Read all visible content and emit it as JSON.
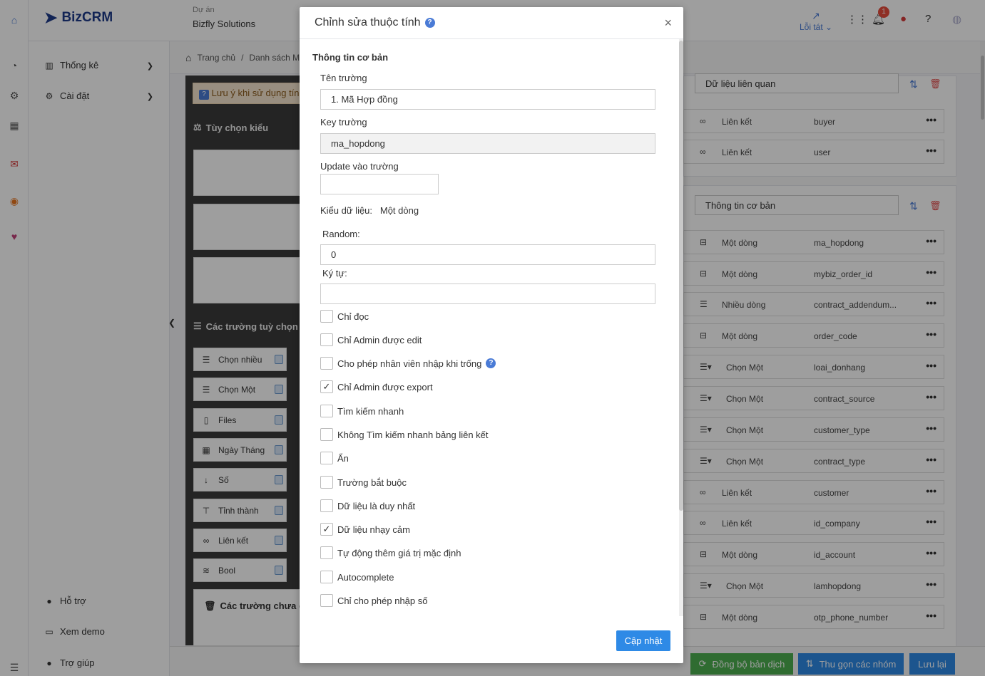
{
  "app": {
    "logo_text": "BizCRM",
    "brand_color": "#1e3a8a"
  },
  "header": {
    "project_label": "Dự án",
    "project_value": "Bizfly Solutions",
    "error_label": "Lỗi tát",
    "notification_count": "1"
  },
  "sidebar": {
    "items": [
      {
        "label": "Thống kê",
        "icon": "bar-chart-icon"
      },
      {
        "label": "Cài đặt",
        "icon": "gear-icon"
      }
    ],
    "bottom_items": [
      {
        "label": "Hỗ trợ",
        "icon": "info-icon"
      },
      {
        "label": "Xem demo",
        "icon": "monitor-icon"
      },
      {
        "label": "Trợ giúp",
        "icon": "help-icon"
      }
    ]
  },
  "breadcrumb": {
    "home": "Trang chủ",
    "separator": "/",
    "current": "Danh sách M"
  },
  "left_panel": {
    "notice": "Lưu ý khi sử dụng tính",
    "style_options_title": "Tùy chọn kiểu",
    "custom_fields_title": "Các trường tuỳ chọn",
    "unused_fields_title": "Các trường chưa dùng",
    "field_types": [
      "Chọn nhiều",
      "Chọn Một",
      "Files",
      "Ngày Tháng",
      "Số",
      "Tỉnh thành",
      "Liên kết",
      "Bool"
    ]
  },
  "right_panel": {
    "group_related": "Dữ liệu liên quan",
    "related_rows": [
      {
        "type": "Liên kết",
        "key": "buyer",
        "icon": "link-icon"
      },
      {
        "type": "Liên kết",
        "key": "user",
        "icon": "link-icon"
      }
    ],
    "group_basic": "Thông tin cơ bản",
    "basic_rows": [
      {
        "type": "Một dòng",
        "key": "ma_hopdong",
        "icon": "single-line-icon"
      },
      {
        "type": "Một dòng",
        "key": "mybiz_order_id",
        "icon": "single-line-icon"
      },
      {
        "type": "Nhiều dòng",
        "key": "contract_addendum...",
        "icon": "multi-line-icon"
      },
      {
        "type": "Một dòng",
        "key": "order_code",
        "icon": "single-line-icon"
      },
      {
        "type": "Chọn Một",
        "key": "loai_donhang",
        "icon": "select-icon"
      },
      {
        "type": "Chọn Một",
        "key": "contract_source",
        "icon": "select-icon"
      },
      {
        "type": "Chọn Một",
        "key": "customer_type",
        "icon": "select-icon"
      },
      {
        "type": "Chọn Một",
        "key": "contract_type",
        "icon": "select-icon"
      },
      {
        "type": "Liên kết",
        "key": "customer",
        "icon": "link-icon"
      },
      {
        "type": "Liên kết",
        "key": "id_company",
        "icon": "link-icon"
      },
      {
        "type": "Một dòng",
        "key": "id_account",
        "icon": "single-line-icon"
      },
      {
        "type": "Chọn Một",
        "key": "lamhopdong",
        "icon": "select-icon"
      },
      {
        "type": "Một dòng",
        "key": "otp_phone_number",
        "icon": "single-line-icon"
      }
    ],
    "more_glyph": "•••"
  },
  "bottom_actions": {
    "sync": "Đồng bộ bản dịch",
    "collapse": "Thu gọn các nhóm",
    "save": "Lưu lại",
    "sync_color": "#4caf50",
    "primary_color": "#2e8ae6"
  },
  "modal": {
    "title": "Chỉnh sửa thuộc tính",
    "section_title": "Thông tin cơ bản",
    "field_name_label": "Tên trường",
    "field_name_value": "1. Mã Hợp đồng",
    "key_label": "Key trường",
    "key_value": "ma_hopdong",
    "update_label": "Update vào trường",
    "update_value": "",
    "data_type_label": "Kiểu dữ liệu:",
    "data_type_value": "Một dòng",
    "random_label": "Random:",
    "random_value": "0",
    "chars_label": "Ký tự:",
    "chars_value": "",
    "checkboxes": [
      {
        "label": "Chỉ đọc",
        "checked": false
      },
      {
        "label": "Chỉ Admin được edit",
        "checked": false
      },
      {
        "label": "Cho phép nhân viên nhập khi trống",
        "checked": false,
        "help": true
      },
      {
        "label": "Chỉ Admin được export",
        "checked": true
      },
      {
        "label": "Tìm kiếm nhanh",
        "checked": false
      },
      {
        "label": "Không Tìm kiếm nhanh bảng liên kết",
        "checked": false
      },
      {
        "label": "Ẩn",
        "checked": false
      },
      {
        "label": "Trường bắt buộc",
        "checked": false
      },
      {
        "label": "Dữ liệu là duy nhất",
        "checked": false
      },
      {
        "label": "Dữ liệu nhạy cảm",
        "checked": true
      },
      {
        "label": "Tự động thêm giá trị mặc định",
        "checked": false
      },
      {
        "label": "Autocomplete",
        "checked": false
      },
      {
        "label": "Chỉ cho phép nhập số",
        "checked": false
      }
    ],
    "submit_label": "Cập nhật",
    "close_glyph": "×",
    "check_glyph": "✓"
  }
}
